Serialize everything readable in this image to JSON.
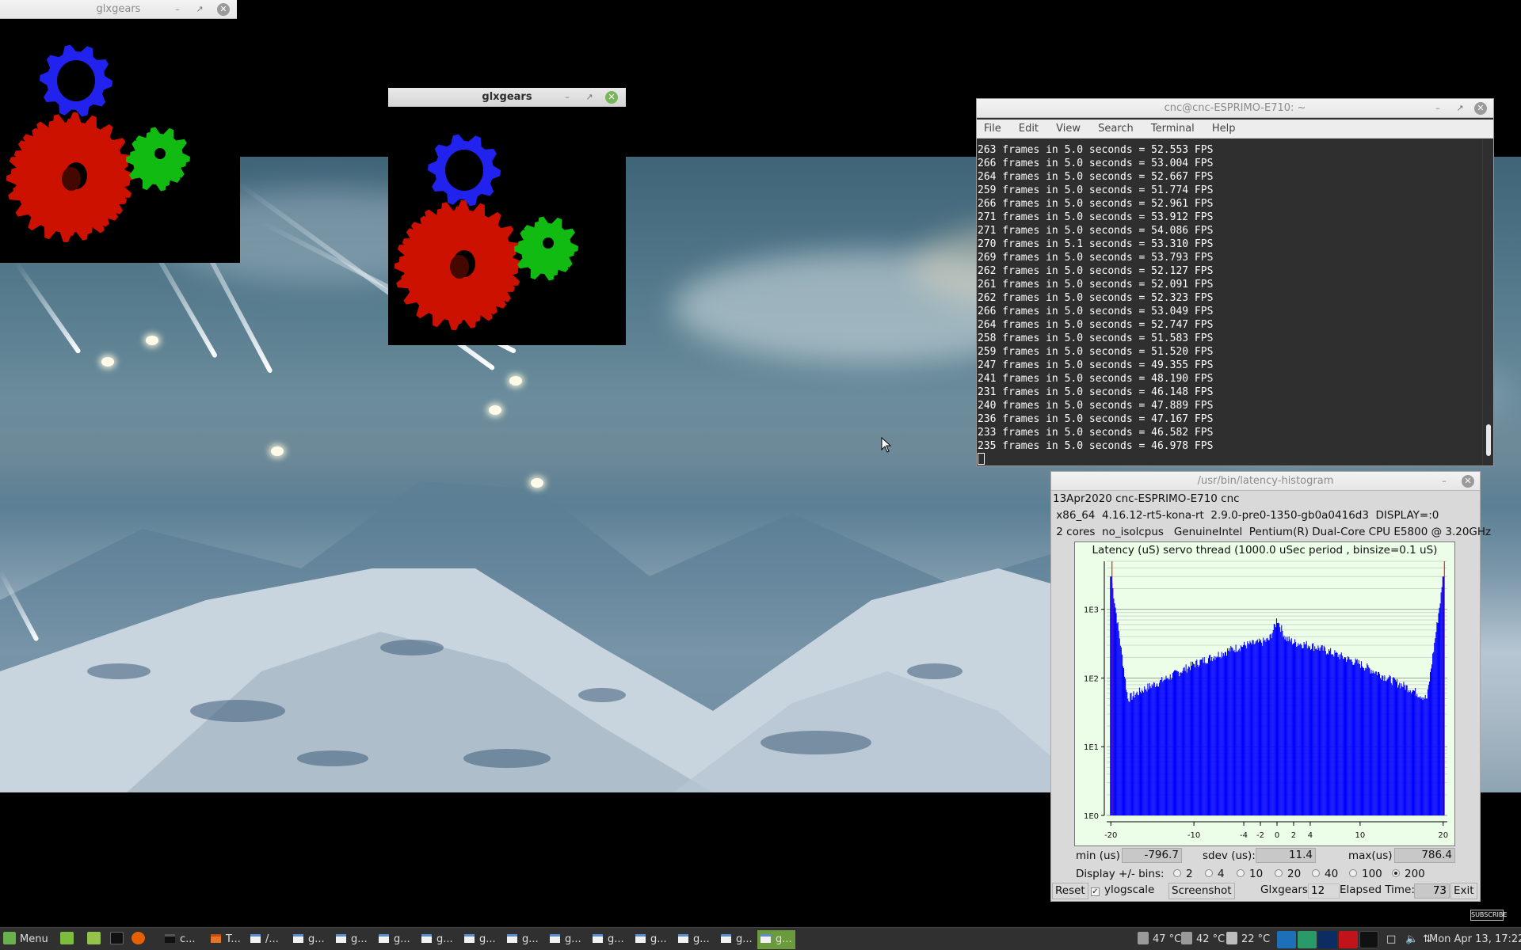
{
  "glxgears_window_1": {
    "title": "glxgears"
  },
  "glxgears_window_2": {
    "title": "glxgears",
    "minimize": "–",
    "maximize": "↗",
    "close": "✕"
  },
  "terminal": {
    "title": "cnc@cnc-ESPRIMO-E710: ~",
    "menu": [
      "File",
      "Edit",
      "View",
      "Search",
      "Terminal",
      "Help"
    ],
    "lines": [
      "263 frames in 5.0 seconds = 52.553 FPS",
      "266 frames in 5.0 seconds = 53.004 FPS",
      "264 frames in 5.0 seconds = 52.667 FPS",
      "259 frames in 5.0 seconds = 51.774 FPS",
      "266 frames in 5.0 seconds = 52.961 FPS",
      "271 frames in 5.0 seconds = 53.912 FPS",
      "271 frames in 5.0 seconds = 54.086 FPS",
      "270 frames in 5.1 seconds = 53.310 FPS",
      "269 frames in 5.0 seconds = 53.793 FPS",
      "262 frames in 5.0 seconds = 52.127 FPS",
      "261 frames in 5.0 seconds = 52.091 FPS",
      "262 frames in 5.0 seconds = 52.323 FPS",
      "266 frames in 5.0 seconds = 53.049 FPS",
      "264 frames in 5.0 seconds = 52.747 FPS",
      "258 frames in 5.0 seconds = 51.583 FPS",
      "259 frames in 5.0 seconds = 51.520 FPS",
      "247 frames in 5.0 seconds = 49.355 FPS",
      "241 frames in 5.0 seconds = 48.190 FPS",
      "231 frames in 5.0 seconds = 46.148 FPS",
      "240 frames in 5.0 seconds = 47.889 FPS",
      "236 frames in 5.0 seconds = 47.167 FPS",
      "233 frames in 5.0 seconds = 46.582 FPS",
      "235 frames in 5.0 seconds = 46.978 FPS"
    ]
  },
  "latency": {
    "title": "/usr/bin/latency-histogram",
    "info_line1": "13Apr2020 cnc-ESPRIMO-E710 cnc",
    "info_line2": " x86_64  4.16.12-rt5-kona-rt  2.9.0-pre0-1350-gb0a0416d3  DISPLAY=:0",
    "info_line3": " 2 cores  no_isolcpus   GenuineIntel  Pentium(R) Dual-Core CPU E5800 @ 3.20GHz",
    "min_label": "min (us)",
    "min_value": "-796.7",
    "sdev_label": "sdev (us):",
    "sdev_value": "11.4",
    "max_label": "max(us)",
    "max_value": "786.4",
    "bins_label": "Display +/- bins:",
    "bins_options": [
      "2",
      "4",
      "10",
      "20",
      "40",
      "100",
      "200"
    ],
    "bins_selected": "200",
    "reset_label": "Reset",
    "ylogscale_label": "ylogscale",
    "screenshot_label": "Screenshot",
    "glxgears_label": "Glxgears",
    "glxgears_value": "12",
    "elapsed_label": "Elapsed Time:",
    "elapsed_value": "73",
    "exit_label": "Exit"
  },
  "chart_data": {
    "type": "bar",
    "title": "Latency (uS) servo thread (1000.0 uSec period , binsize=0.1 uS)",
    "xlabel": "",
    "ylabel": "",
    "x_ticks": [
      "-20",
      "-10",
      "-4",
      "-2",
      "0",
      "2",
      "4",
      "10",
      "20"
    ],
    "x_tick_values": [
      -20,
      -10,
      -4,
      -2,
      0,
      2,
      4,
      10,
      20
    ],
    "y_ticks": [
      "1E0",
      "1E1",
      "1E2",
      "1E3"
    ],
    "y_scale": "log",
    "xlim": [
      -20.5,
      20.5
    ],
    "ylim": [
      1,
      5000
    ],
    "x": [
      -20,
      -18,
      -16,
      -14,
      -12,
      -10,
      -8,
      -6,
      -4,
      -2,
      -1,
      0,
      1,
      2,
      4,
      6,
      8,
      10,
      12,
      14,
      16,
      18,
      20
    ],
    "values": [
      3000,
      50,
      70,
      90,
      120,
      160,
      200,
      250,
      300,
      330,
      360,
      700,
      380,
      330,
      300,
      250,
      200,
      160,
      120,
      90,
      70,
      50,
      3000
    ],
    "grid": true,
    "bar_color": "#0000ff"
  },
  "taskbar": {
    "menu_label": "Menu",
    "tasks": [
      "c...",
      "T...",
      "/...",
      "g...",
      "g...",
      "g...",
      "g...",
      "g...",
      "g...",
      "g...",
      "g...",
      "g...",
      "g...",
      "g...",
      "g..."
    ],
    "temp1": "47 °C",
    "temp2": "42 °C",
    "temp3": "22 °C",
    "clock": "Mon Apr 13, 17:22"
  },
  "subscribe": "SUBSCRIBE",
  "colors": {
    "gear_red": "#cc1100",
    "gear_green": "#11bb11",
    "gear_blue": "#2222ee",
    "taskbar_active": "#6a9a3b"
  }
}
